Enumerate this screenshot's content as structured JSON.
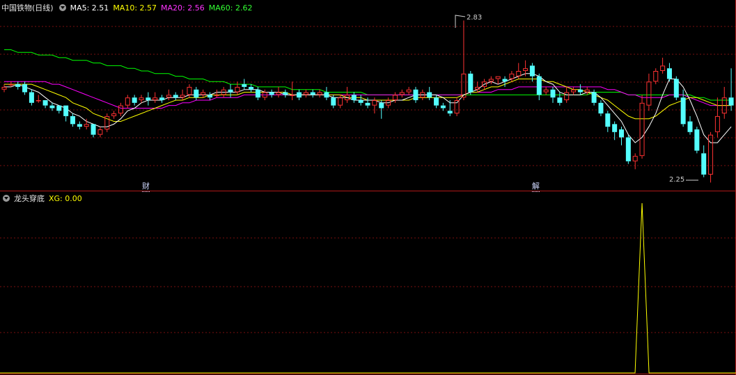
{
  "legend_top": {
    "title": "中国铁物(日线)",
    "ma5": "MA5: 2.51",
    "ma10": "MA10: 2.57",
    "ma20": "MA20: 2.56",
    "ma60": "MA60: 2.62"
  },
  "legend_bottom": {
    "title": "龙头穿底",
    "xg": "XG: 0.00"
  },
  "events": {
    "finance": "财",
    "unlock": "解"
  },
  "annotations": {
    "high": "2.83",
    "low": "2.25"
  },
  "colors": {
    "up": "#ff3232",
    "down": "#54ffff",
    "ma5": "#ffffff",
    "ma10": "#ffff00",
    "ma20": "#ff00ff",
    "ma60": "#00ff00",
    "grid": "#7a1010",
    "xg": "#ffff00"
  },
  "chart_data": [
    {
      "type": "candlestick",
      "ylim": [
        2.2,
        2.86
      ],
      "candles": [
        [
          2.57,
          2.58,
          2.56,
          2.59
        ],
        [
          2.59,
          2.59,
          2.58,
          2.6
        ],
        [
          2.59,
          2.58,
          2.57,
          2.6
        ],
        [
          2.59,
          2.56,
          2.55,
          2.6
        ],
        [
          2.56,
          2.52,
          2.51,
          2.57
        ],
        [
          2.53,
          2.53,
          2.52,
          2.55
        ],
        [
          2.53,
          2.51,
          2.5,
          2.53
        ],
        [
          2.51,
          2.5,
          2.49,
          2.52
        ],
        [
          2.51,
          2.49,
          2.48,
          2.51
        ],
        [
          2.51,
          2.47,
          2.45,
          2.51
        ],
        [
          2.47,
          2.44,
          2.43,
          2.48
        ],
        [
          2.44,
          2.43,
          2.42,
          2.45
        ],
        [
          2.43,
          2.44,
          2.42,
          2.46
        ],
        [
          2.44,
          2.4,
          2.39,
          2.44
        ],
        [
          2.4,
          2.42,
          2.39,
          2.43
        ],
        [
          2.42,
          2.47,
          2.41,
          2.48
        ],
        [
          2.47,
          2.48,
          2.46,
          2.49
        ],
        [
          2.48,
          2.51,
          2.47,
          2.52
        ],
        [
          2.51,
          2.54,
          2.5,
          2.55
        ],
        [
          2.54,
          2.52,
          2.51,
          2.55
        ],
        [
          2.53,
          2.54,
          2.52,
          2.55
        ],
        [
          2.54,
          2.53,
          2.51,
          2.56
        ],
        [
          2.53,
          2.54,
          2.52,
          2.56
        ],
        [
          2.54,
          2.53,
          2.52,
          2.55
        ],
        [
          2.54,
          2.55,
          2.53,
          2.57
        ],
        [
          2.55,
          2.54,
          2.53,
          2.56
        ],
        [
          2.54,
          2.55,
          2.53,
          2.57
        ],
        [
          2.55,
          2.58,
          2.54,
          2.59
        ],
        [
          2.57,
          2.54,
          2.53,
          2.58
        ],
        [
          2.55,
          2.56,
          2.54,
          2.57
        ],
        [
          2.55,
          2.54,
          2.53,
          2.56
        ],
        [
          2.55,
          2.55,
          2.54,
          2.57
        ],
        [
          2.55,
          2.57,
          2.54,
          2.58
        ],
        [
          2.57,
          2.56,
          2.54,
          2.59
        ],
        [
          2.56,
          2.58,
          2.55,
          2.6
        ],
        [
          2.59,
          2.58,
          2.57,
          2.61
        ],
        [
          2.58,
          2.57,
          2.56,
          2.59
        ],
        [
          2.57,
          2.54,
          2.53,
          2.58
        ],
        [
          2.54,
          2.56,
          2.53,
          2.57
        ],
        [
          2.56,
          2.55,
          2.54,
          2.57
        ],
        [
          2.55,
          2.56,
          2.54,
          2.58
        ],
        [
          2.56,
          2.55,
          2.54,
          2.57
        ],
        [
          2.55,
          2.55,
          2.53,
          2.6
        ],
        [
          2.56,
          2.54,
          2.53,
          2.57
        ],
        [
          2.55,
          2.56,
          2.54,
          2.57
        ],
        [
          2.56,
          2.55,
          2.54,
          2.57
        ],
        [
          2.55,
          2.56,
          2.54,
          2.57
        ],
        [
          2.56,
          2.54,
          2.53,
          2.58
        ],
        [
          2.54,
          2.51,
          2.5,
          2.55
        ],
        [
          2.51,
          2.54,
          2.5,
          2.55
        ],
        [
          2.53,
          2.55,
          2.52,
          2.58
        ],
        [
          2.55,
          2.53,
          2.52,
          2.56
        ],
        [
          2.53,
          2.52,
          2.51,
          2.55
        ],
        [
          2.52,
          2.51,
          2.5,
          2.54
        ],
        [
          2.51,
          2.53,
          2.48,
          2.54
        ],
        [
          2.52,
          2.5,
          2.46,
          2.53
        ],
        [
          2.51,
          2.53,
          2.5,
          2.54
        ],
        [
          2.53,
          2.55,
          2.52,
          2.56
        ],
        [
          2.55,
          2.56,
          2.54,
          2.57
        ],
        [
          2.56,
          2.57,
          2.55,
          2.58
        ],
        [
          2.57,
          2.53,
          2.52,
          2.58
        ],
        [
          2.54,
          2.56,
          2.53,
          2.57
        ],
        [
          2.56,
          2.54,
          2.53,
          2.58
        ],
        [
          2.54,
          2.51,
          2.5,
          2.55
        ],
        [
          2.51,
          2.5,
          2.49,
          2.52
        ],
        [
          2.49,
          2.48,
          2.47,
          2.53
        ],
        [
          2.48,
          2.53,
          2.47,
          2.54
        ],
        [
          2.54,
          2.63,
          2.53,
          2.83
        ],
        [
          2.63,
          2.56,
          2.55,
          2.64
        ],
        [
          2.57,
          2.58,
          2.56,
          2.6
        ],
        [
          2.58,
          2.6,
          2.57,
          2.61
        ],
        [
          2.6,
          2.61,
          2.59,
          2.62
        ],
        [
          2.61,
          2.62,
          2.59,
          2.62
        ],
        [
          2.61,
          2.6,
          2.58,
          2.62
        ],
        [
          2.61,
          2.63,
          2.6,
          2.64
        ],
        [
          2.62,
          2.64,
          2.61,
          2.67
        ],
        [
          2.64,
          2.65,
          2.62,
          2.68
        ],
        [
          2.66,
          2.62,
          2.6,
          2.67
        ],
        [
          2.62,
          2.55,
          2.53,
          2.63
        ],
        [
          2.56,
          2.57,
          2.55,
          2.58
        ],
        [
          2.57,
          2.54,
          2.52,
          2.58
        ],
        [
          2.54,
          2.52,
          2.51,
          2.56
        ],
        [
          2.53,
          2.56,
          2.52,
          2.58
        ],
        [
          2.56,
          2.57,
          2.55,
          2.58
        ],
        [
          2.57,
          2.56,
          2.55,
          2.59
        ],
        [
          2.56,
          2.57,
          2.55,
          2.58
        ],
        [
          2.56,
          2.52,
          2.51,
          2.57
        ],
        [
          2.52,
          2.48,
          2.47,
          2.53
        ],
        [
          2.48,
          2.43,
          2.41,
          2.49
        ],
        [
          2.44,
          2.41,
          2.38,
          2.45
        ],
        [
          2.42,
          2.39,
          2.36,
          2.43
        ],
        [
          2.39,
          2.3,
          2.29,
          2.4
        ],
        [
          2.3,
          2.32,
          2.27,
          2.33
        ],
        [
          2.32,
          2.52,
          2.31,
          2.55
        ],
        [
          2.51,
          2.6,
          2.49,
          2.63
        ],
        [
          2.6,
          2.64,
          2.59,
          2.65
        ],
        [
          2.64,
          2.66,
          2.63,
          2.69
        ],
        [
          2.65,
          2.61,
          2.6,
          2.67
        ],
        [
          2.61,
          2.54,
          2.53,
          2.62
        ],
        [
          2.54,
          2.44,
          2.43,
          2.57
        ],
        [
          2.45,
          2.41,
          2.4,
          2.47
        ],
        [
          2.42,
          2.34,
          2.33,
          2.43
        ],
        [
          2.33,
          2.25,
          2.24,
          2.36
        ],
        [
          2.25,
          2.4,
          2.22,
          2.41
        ],
        [
          2.41,
          2.47,
          2.39,
          2.54
        ],
        [
          2.48,
          2.54,
          2.46,
          2.58
        ],
        [
          2.54,
          2.51,
          2.49,
          2.65
        ]
      ],
      "ma5": [
        2.58,
        2.58,
        2.59,
        2.58,
        2.57,
        2.56,
        2.54,
        2.52,
        2.51,
        2.5,
        2.48,
        2.47,
        2.45,
        2.44,
        2.43,
        2.43,
        2.44,
        2.46,
        2.49,
        2.5,
        2.52,
        2.53,
        2.53,
        2.53,
        2.54,
        2.54,
        2.54,
        2.55,
        2.55,
        2.55,
        2.55,
        2.56,
        2.56,
        2.56,
        2.56,
        2.57,
        2.57,
        2.57,
        2.56,
        2.56,
        2.56,
        2.55,
        2.55,
        2.55,
        2.55,
        2.55,
        2.55,
        2.55,
        2.54,
        2.54,
        2.54,
        2.53,
        2.53,
        2.53,
        2.53,
        2.52,
        2.52,
        2.53,
        2.53,
        2.54,
        2.55,
        2.55,
        2.55,
        2.55,
        2.54,
        2.52,
        2.52,
        2.55,
        2.56,
        2.57,
        2.59,
        2.6,
        2.59,
        2.6,
        2.61,
        2.62,
        2.63,
        2.63,
        2.62,
        2.6,
        2.59,
        2.56,
        2.55,
        2.55,
        2.55,
        2.56,
        2.56,
        2.54,
        2.51,
        2.48,
        2.45,
        2.4,
        2.37,
        2.39,
        2.43,
        2.48,
        2.55,
        2.61,
        2.61,
        2.58,
        2.53,
        2.47,
        2.4,
        2.37,
        2.37,
        2.4,
        2.43
      ],
      "ma10": [
        2.59,
        2.59,
        2.59,
        2.59,
        2.59,
        2.58,
        2.57,
        2.56,
        2.55,
        2.54,
        2.52,
        2.51,
        2.5,
        2.48,
        2.47,
        2.46,
        2.45,
        2.45,
        2.46,
        2.47,
        2.48,
        2.49,
        2.5,
        2.51,
        2.52,
        2.53,
        2.53,
        2.54,
        2.54,
        2.54,
        2.55,
        2.55,
        2.55,
        2.55,
        2.55,
        2.56,
        2.56,
        2.56,
        2.56,
        2.56,
        2.56,
        2.56,
        2.55,
        2.55,
        2.55,
        2.55,
        2.55,
        2.55,
        2.55,
        2.55,
        2.54,
        2.54,
        2.54,
        2.53,
        2.53,
        2.53,
        2.53,
        2.53,
        2.53,
        2.53,
        2.54,
        2.54,
        2.54,
        2.54,
        2.54,
        2.54,
        2.54,
        2.55,
        2.56,
        2.56,
        2.57,
        2.58,
        2.58,
        2.59,
        2.6,
        2.61,
        2.61,
        2.61,
        2.61,
        2.6,
        2.6,
        2.59,
        2.58,
        2.57,
        2.57,
        2.56,
        2.55,
        2.54,
        2.53,
        2.51,
        2.49,
        2.47,
        2.46,
        2.46,
        2.46,
        2.47,
        2.49,
        2.51,
        2.52,
        2.53,
        2.54,
        2.54,
        2.53,
        2.52,
        2.51,
        2.51,
        2.51
      ],
      "ma20": [
        2.6,
        2.6,
        2.6,
        2.6,
        2.6,
        2.6,
        2.6,
        2.59,
        2.59,
        2.58,
        2.57,
        2.56,
        2.55,
        2.54,
        2.53,
        2.52,
        2.51,
        2.5,
        2.5,
        2.5,
        2.5,
        2.5,
        2.5,
        2.5,
        2.51,
        2.51,
        2.52,
        2.52,
        2.53,
        2.53,
        2.53,
        2.54,
        2.54,
        2.54,
        2.54,
        2.55,
        2.55,
        2.55,
        2.55,
        2.55,
        2.55,
        2.55,
        2.55,
        2.55,
        2.55,
        2.55,
        2.55,
        2.55,
        2.55,
        2.55,
        2.55,
        2.55,
        2.55,
        2.55,
        2.55,
        2.55,
        2.55,
        2.55,
        2.55,
        2.55,
        2.55,
        2.55,
        2.55,
        2.55,
        2.55,
        2.55,
        2.55,
        2.55,
        2.56,
        2.56,
        2.56,
        2.56,
        2.57,
        2.57,
        2.57,
        2.58,
        2.58,
        2.58,
        2.58,
        2.58,
        2.58,
        2.58,
        2.58,
        2.58,
        2.58,
        2.58,
        2.58,
        2.58,
        2.57,
        2.57,
        2.56,
        2.55,
        2.55,
        2.54,
        2.54,
        2.54,
        2.54,
        2.55,
        2.55,
        2.55,
        2.54,
        2.53,
        2.52,
        2.51,
        2.51,
        2.51,
        2.51
      ],
      "ma60": [
        2.72,
        2.72,
        2.71,
        2.71,
        2.71,
        2.7,
        2.7,
        2.7,
        2.69,
        2.69,
        2.68,
        2.68,
        2.68,
        2.67,
        2.67,
        2.66,
        2.66,
        2.66,
        2.65,
        2.65,
        2.64,
        2.64,
        2.63,
        2.63,
        2.63,
        2.62,
        2.62,
        2.61,
        2.61,
        2.61,
        2.6,
        2.6,
        2.6,
        2.59,
        2.59,
        2.59,
        2.59,
        2.58,
        2.58,
        2.58,
        2.58,
        2.58,
        2.57,
        2.57,
        2.57,
        2.57,
        2.57,
        2.56,
        2.56,
        2.56,
        2.56,
        2.56,
        2.56,
        2.55,
        2.55,
        2.55,
        2.55,
        2.55,
        2.55,
        2.55,
        2.55,
        2.55,
        2.55,
        2.55,
        2.55,
        2.55,
        2.55,
        2.55,
        2.55,
        2.55,
        2.55,
        2.55,
        2.55,
        2.55,
        2.55,
        2.55,
        2.55,
        2.55,
        2.55,
        2.55,
        2.55,
        2.55,
        2.55,
        2.55,
        2.55,
        2.55,
        2.56,
        2.56,
        2.56,
        2.56,
        2.56,
        2.55,
        2.55,
        2.55,
        2.55,
        2.55,
        2.55,
        2.55,
        2.55,
        2.55,
        2.55,
        2.54,
        2.54,
        2.53,
        2.53,
        2.53,
        2.53
      ]
    },
    {
      "type": "line",
      "name": "XG",
      "ylim": [
        0,
        1
      ],
      "spike_index": 93,
      "values": "0 everywhere except 1 at spike_index"
    }
  ]
}
